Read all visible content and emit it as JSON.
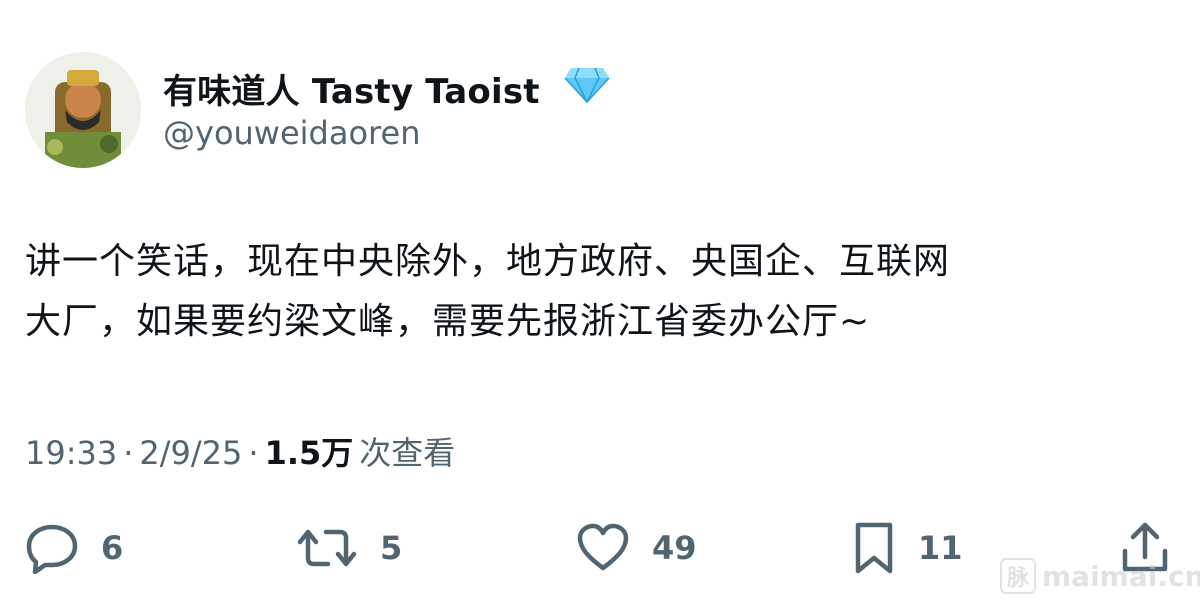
{
  "author": {
    "display_name": "有味道人 Tasty Taoist",
    "handle": "@youweidaoren",
    "verified_icon": "diamond-icon",
    "verified_color": "#5bc8f5"
  },
  "tweet": {
    "lines": [
      "讲一个笑话，现在中央除外，地方政府、央国企、互联网",
      "大厂，如果要约梁文峰，需要先报浙江省委办公厅~"
    ]
  },
  "meta": {
    "time": "19:33",
    "separator": "·",
    "date": "2/9/25",
    "views_count": "1.5万",
    "views_label": "次查看"
  },
  "actions": {
    "reply": {
      "icon": "reply-icon",
      "count": "6"
    },
    "retweet": {
      "icon": "retweet-icon",
      "count": "5"
    },
    "like": {
      "icon": "heart-icon",
      "count": "49"
    },
    "bookmark": {
      "icon": "bookmark-icon",
      "count": "11"
    },
    "share": {
      "icon": "share-icon"
    }
  },
  "watermark": {
    "logo_char": "脉",
    "text": "maimai.cn"
  },
  "colors": {
    "text_primary": "#0f1419",
    "text_secondary": "#536471"
  }
}
